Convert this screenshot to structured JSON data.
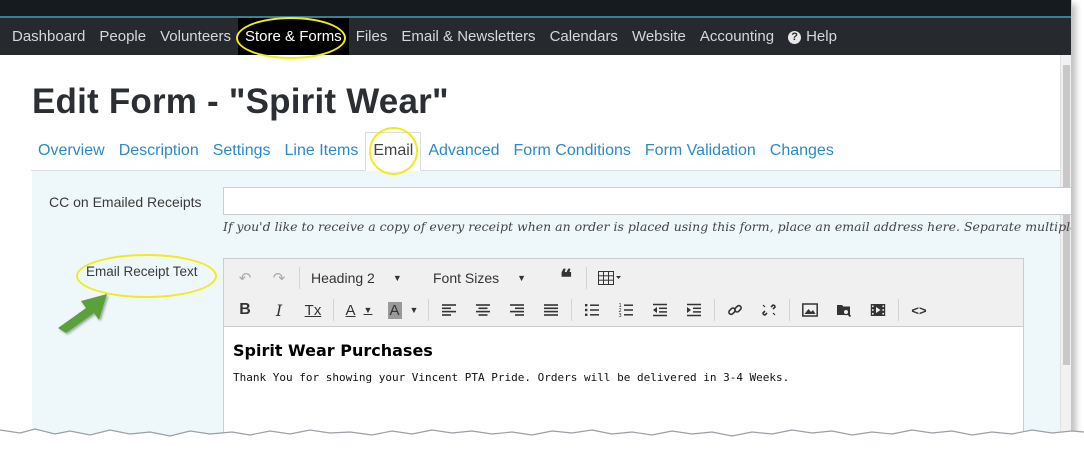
{
  "nav": {
    "items": [
      {
        "label": "Dashboard"
      },
      {
        "label": "People"
      },
      {
        "label": "Volunteers"
      },
      {
        "label": "Store & Forms"
      },
      {
        "label": "Files"
      },
      {
        "label": "Email & Newsletters"
      },
      {
        "label": "Calendars"
      },
      {
        "label": "Website"
      },
      {
        "label": "Accounting"
      },
      {
        "label": "Help"
      }
    ],
    "active": "Store & Forms",
    "help_icon": "?"
  },
  "page": {
    "title": "Edit Form - \"Spirit Wear\""
  },
  "tabs": [
    {
      "label": "Overview"
    },
    {
      "label": "Description"
    },
    {
      "label": "Settings"
    },
    {
      "label": "Line Items"
    },
    {
      "label": "Email"
    },
    {
      "label": "Advanced"
    },
    {
      "label": "Form Conditions"
    },
    {
      "label": "Form Validation"
    },
    {
      "label": "Changes"
    }
  ],
  "active_tab": "Email",
  "form": {
    "cc_label": "CC on Emailed Receipts",
    "cc_value": "",
    "cc_help": "If you'd like to receive a copy of every receipt when an order is placed using this form, place an email address here. Separate multiple ad",
    "receipt_label": "Email Receipt Text"
  },
  "editor": {
    "block_format": "Heading 2",
    "font_sizes": "Font Sizes",
    "icons": {
      "undo": "↶",
      "redo": "↷",
      "blockquote": "❝",
      "table": "▦",
      "bold": "B",
      "italic": "I",
      "clear_format": "Tx",
      "text_color": "A",
      "bg_color": "A",
      "source_code": "<>"
    },
    "content_heading": "Spirit Wear Purchases",
    "content_body": "Thank You for showing your Vincent PTA Pride.  Orders will be delivered in 3-4 Weeks."
  },
  "annotations": {
    "highlight_color": "#f2ea1b",
    "arrow_color": "#5aa13a"
  },
  "colors": {
    "link": "#2b8ac6",
    "nav_bg": "#262a2e",
    "panel_bg": "#eef8fb"
  }
}
